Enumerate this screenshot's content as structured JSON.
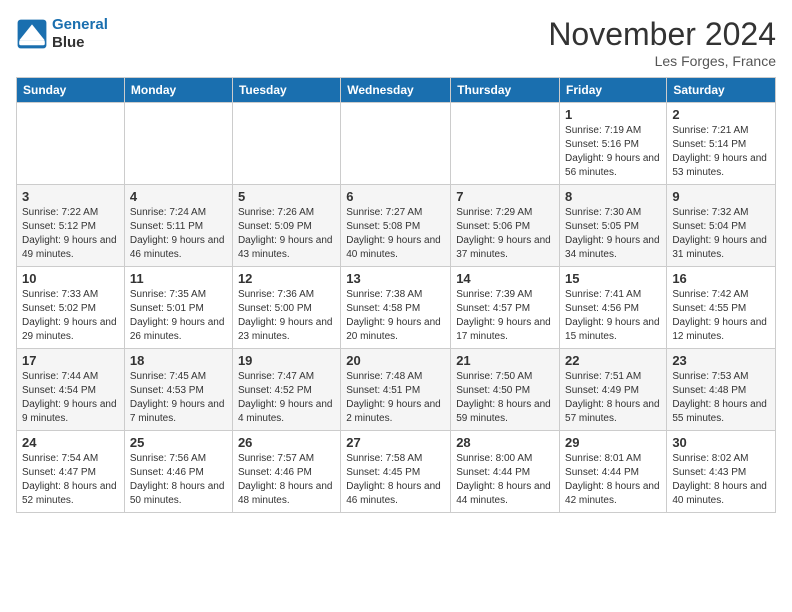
{
  "header": {
    "logo_line1": "General",
    "logo_line2": "Blue",
    "month": "November 2024",
    "location": "Les Forges, France"
  },
  "weekdays": [
    "Sunday",
    "Monday",
    "Tuesday",
    "Wednesday",
    "Thursday",
    "Friday",
    "Saturday"
  ],
  "weeks": [
    [
      {
        "day": "",
        "info": ""
      },
      {
        "day": "",
        "info": ""
      },
      {
        "day": "",
        "info": ""
      },
      {
        "day": "",
        "info": ""
      },
      {
        "day": "",
        "info": ""
      },
      {
        "day": "1",
        "info": "Sunrise: 7:19 AM\nSunset: 5:16 PM\nDaylight: 9 hours and 56 minutes."
      },
      {
        "day": "2",
        "info": "Sunrise: 7:21 AM\nSunset: 5:14 PM\nDaylight: 9 hours and 53 minutes."
      }
    ],
    [
      {
        "day": "3",
        "info": "Sunrise: 7:22 AM\nSunset: 5:12 PM\nDaylight: 9 hours and 49 minutes."
      },
      {
        "day": "4",
        "info": "Sunrise: 7:24 AM\nSunset: 5:11 PM\nDaylight: 9 hours and 46 minutes."
      },
      {
        "day": "5",
        "info": "Sunrise: 7:26 AM\nSunset: 5:09 PM\nDaylight: 9 hours and 43 minutes."
      },
      {
        "day": "6",
        "info": "Sunrise: 7:27 AM\nSunset: 5:08 PM\nDaylight: 9 hours and 40 minutes."
      },
      {
        "day": "7",
        "info": "Sunrise: 7:29 AM\nSunset: 5:06 PM\nDaylight: 9 hours and 37 minutes."
      },
      {
        "day": "8",
        "info": "Sunrise: 7:30 AM\nSunset: 5:05 PM\nDaylight: 9 hours and 34 minutes."
      },
      {
        "day": "9",
        "info": "Sunrise: 7:32 AM\nSunset: 5:04 PM\nDaylight: 9 hours and 31 minutes."
      }
    ],
    [
      {
        "day": "10",
        "info": "Sunrise: 7:33 AM\nSunset: 5:02 PM\nDaylight: 9 hours and 29 minutes."
      },
      {
        "day": "11",
        "info": "Sunrise: 7:35 AM\nSunset: 5:01 PM\nDaylight: 9 hours and 26 minutes."
      },
      {
        "day": "12",
        "info": "Sunrise: 7:36 AM\nSunset: 5:00 PM\nDaylight: 9 hours and 23 minutes."
      },
      {
        "day": "13",
        "info": "Sunrise: 7:38 AM\nSunset: 4:58 PM\nDaylight: 9 hours and 20 minutes."
      },
      {
        "day": "14",
        "info": "Sunrise: 7:39 AM\nSunset: 4:57 PM\nDaylight: 9 hours and 17 minutes."
      },
      {
        "day": "15",
        "info": "Sunrise: 7:41 AM\nSunset: 4:56 PM\nDaylight: 9 hours and 15 minutes."
      },
      {
        "day": "16",
        "info": "Sunrise: 7:42 AM\nSunset: 4:55 PM\nDaylight: 9 hours and 12 minutes."
      }
    ],
    [
      {
        "day": "17",
        "info": "Sunrise: 7:44 AM\nSunset: 4:54 PM\nDaylight: 9 hours and 9 minutes."
      },
      {
        "day": "18",
        "info": "Sunrise: 7:45 AM\nSunset: 4:53 PM\nDaylight: 9 hours and 7 minutes."
      },
      {
        "day": "19",
        "info": "Sunrise: 7:47 AM\nSunset: 4:52 PM\nDaylight: 9 hours and 4 minutes."
      },
      {
        "day": "20",
        "info": "Sunrise: 7:48 AM\nSunset: 4:51 PM\nDaylight: 9 hours and 2 minutes."
      },
      {
        "day": "21",
        "info": "Sunrise: 7:50 AM\nSunset: 4:50 PM\nDaylight: 8 hours and 59 minutes."
      },
      {
        "day": "22",
        "info": "Sunrise: 7:51 AM\nSunset: 4:49 PM\nDaylight: 8 hours and 57 minutes."
      },
      {
        "day": "23",
        "info": "Sunrise: 7:53 AM\nSunset: 4:48 PM\nDaylight: 8 hours and 55 minutes."
      }
    ],
    [
      {
        "day": "24",
        "info": "Sunrise: 7:54 AM\nSunset: 4:47 PM\nDaylight: 8 hours and 52 minutes."
      },
      {
        "day": "25",
        "info": "Sunrise: 7:56 AM\nSunset: 4:46 PM\nDaylight: 8 hours and 50 minutes."
      },
      {
        "day": "26",
        "info": "Sunrise: 7:57 AM\nSunset: 4:46 PM\nDaylight: 8 hours and 48 minutes."
      },
      {
        "day": "27",
        "info": "Sunrise: 7:58 AM\nSunset: 4:45 PM\nDaylight: 8 hours and 46 minutes."
      },
      {
        "day": "28",
        "info": "Sunrise: 8:00 AM\nSunset: 4:44 PM\nDaylight: 8 hours and 44 minutes."
      },
      {
        "day": "29",
        "info": "Sunrise: 8:01 AM\nSunset: 4:44 PM\nDaylight: 8 hours and 42 minutes."
      },
      {
        "day": "30",
        "info": "Sunrise: 8:02 AM\nSunset: 4:43 PM\nDaylight: 8 hours and 40 minutes."
      }
    ]
  ]
}
